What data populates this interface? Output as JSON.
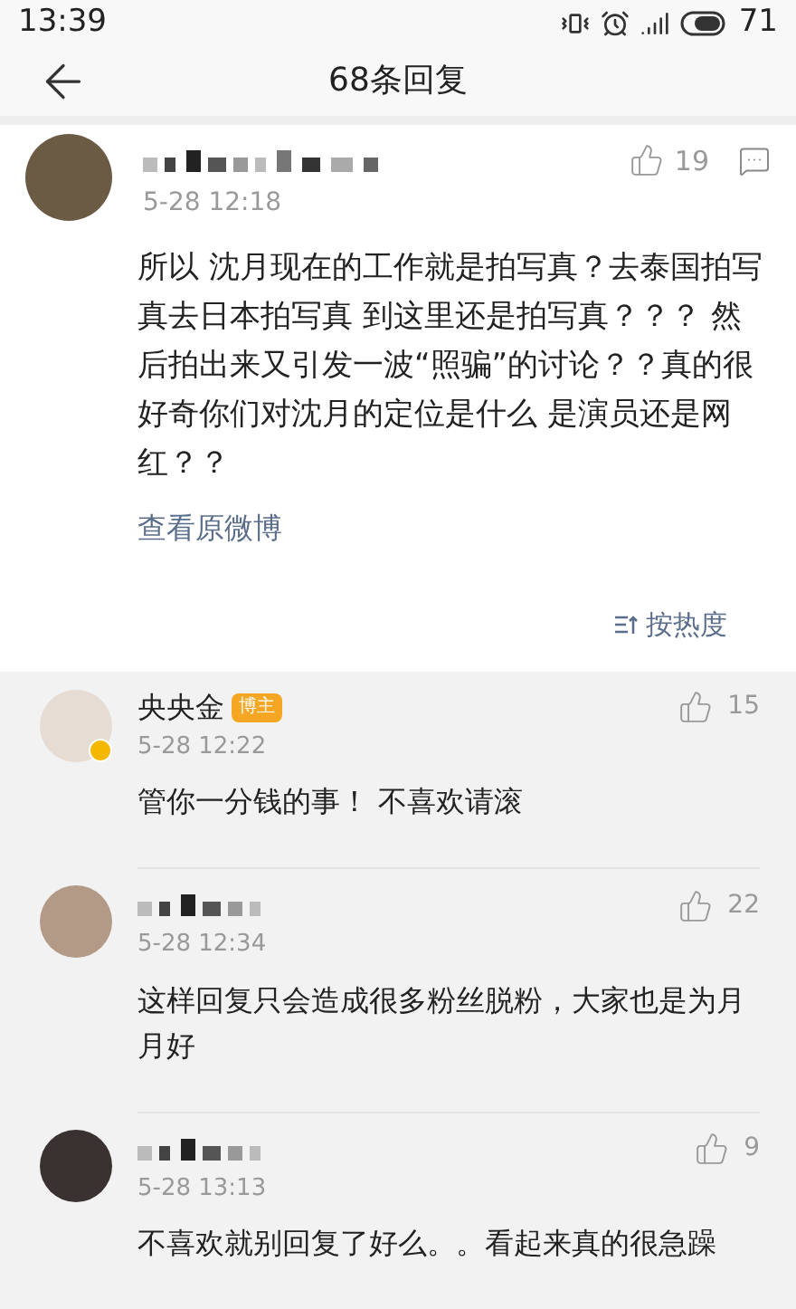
{
  "status_bar": {
    "time": "13:39",
    "battery": "71"
  },
  "header": {
    "title": "68条回复"
  },
  "main_comment": {
    "author": {
      "kind": "blurred"
    },
    "date": "5-28 12:18",
    "likes": "19",
    "text": "所以 沈月现在的工作就是拍写真？去泰国拍写真去日本拍写真 到这里还是拍写真？？？ 然后拍出来又引发一波“照骗”的讨论？？真的很好奇你们对沈月的定位是什么 是演员还是网红？？",
    "link": "查看原微博",
    "sort": "按热度"
  },
  "replies": [
    {
      "author": {
        "kind": "named",
        "name": "央央金",
        "badge": "博主"
      },
      "verified": true,
      "date": "5-28 12:22",
      "likes": "15",
      "text": "管你一分钱的事！ 不喜欢请滚"
    },
    {
      "author": {
        "kind": "blurred"
      },
      "verified": false,
      "date": "5-28 12:34",
      "likes": "22",
      "text": "这样回复只会造成很多粉丝脱粉，大家也是为月月好"
    },
    {
      "author": {
        "kind": "blurred"
      },
      "verified": false,
      "date": "5-28 13:13",
      "likes": "9",
      "text": "不喜欢就别回复了好么。。看起来真的很急躁"
    }
  ]
}
